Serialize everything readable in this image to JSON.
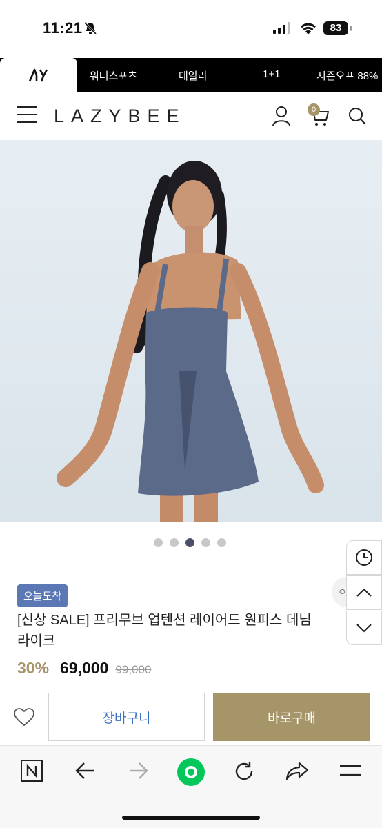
{
  "status": {
    "time": "11:21",
    "battery": "83"
  },
  "nav": {
    "logo_text": "AY",
    "categories": [
      "워터스포츠",
      "데일리",
      "1+1",
      "시즌오프 88%"
    ]
  },
  "header": {
    "brand": "LAZYBEE",
    "cart_count": "0"
  },
  "gallery": {
    "dot_count": 5,
    "active_index": 2
  },
  "product": {
    "badge": "오늘도착",
    "title": "[신상 SALE] 프리무브 업텐션 레이어드 원피스 데님라이크",
    "discount": "30%",
    "price": "69,000",
    "original_price": "99,000"
  },
  "side_controls": {
    "chip": "ㅇ"
  },
  "actions": {
    "cart_label": "장바구니",
    "buy_label": "바로구매"
  },
  "colors": {
    "accent_gold": "#a7956a",
    "badge_blue": "#5b78b4",
    "link_blue": "#3b6fc4"
  },
  "icons": {
    "status": [
      "bell-slash-icon",
      "signal-icon",
      "wifi-icon",
      "battery-icon"
    ],
    "header": [
      "menu-icon",
      "user-icon",
      "cart-icon",
      "search-icon"
    ],
    "side": [
      "history-clock-icon",
      "chevron-up-icon",
      "chevron-down-icon"
    ],
    "toolbar": [
      "naver-n-icon",
      "back-arrow-icon",
      "forward-arrow-icon",
      "green-dot-icon",
      "refresh-icon",
      "share-icon",
      "hamburger-icon"
    ]
  }
}
